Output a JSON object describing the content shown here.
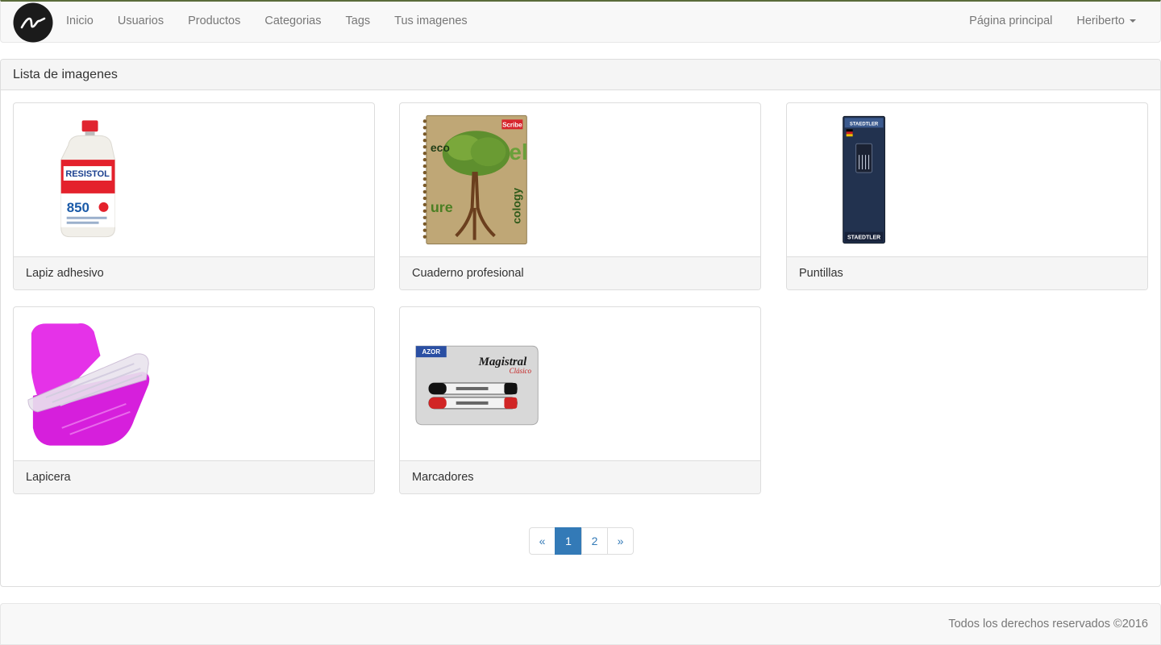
{
  "navbar": {
    "brand_icon": "logo-icon",
    "items": [
      {
        "label": "Inicio"
      },
      {
        "label": "Usuarios"
      },
      {
        "label": "Productos"
      },
      {
        "label": "Categorias"
      },
      {
        "label": "Tags"
      },
      {
        "label": "Tus imagenes"
      }
    ],
    "right": {
      "home_label": "Página principal",
      "user_label": "Heriberto"
    }
  },
  "panel": {
    "title": "Lista de imagenes",
    "images": [
      {
        "name": "Lapiz adhesivo",
        "brand": "RESISTOL",
        "badge": "850",
        "image_icon": "glue-bottle-image"
      },
      {
        "name": "Cuaderno profesional",
        "brand": "Scribe",
        "image_icon": "notebook-image"
      },
      {
        "name": "Puntillas",
        "brand": "STAEDTLER",
        "image_icon": "pencil-leads-image"
      },
      {
        "name": "Lapicera",
        "image_icon": "pencil-case-image"
      },
      {
        "name": "Marcadores",
        "brand": "AZOR",
        "product": "Magistral",
        "subtitle": "Clásico",
        "image_icon": "markers-image"
      }
    ]
  },
  "pagination": {
    "prev": "«",
    "pages": [
      "1",
      "2"
    ],
    "active": "1",
    "next": "»"
  },
  "footer": {
    "text": "Todos los derechos reservados ©2016"
  },
  "colors": {
    "accent": "#337ab7",
    "navbar_bg": "#f8f8f8",
    "text_muted": "#777777"
  }
}
